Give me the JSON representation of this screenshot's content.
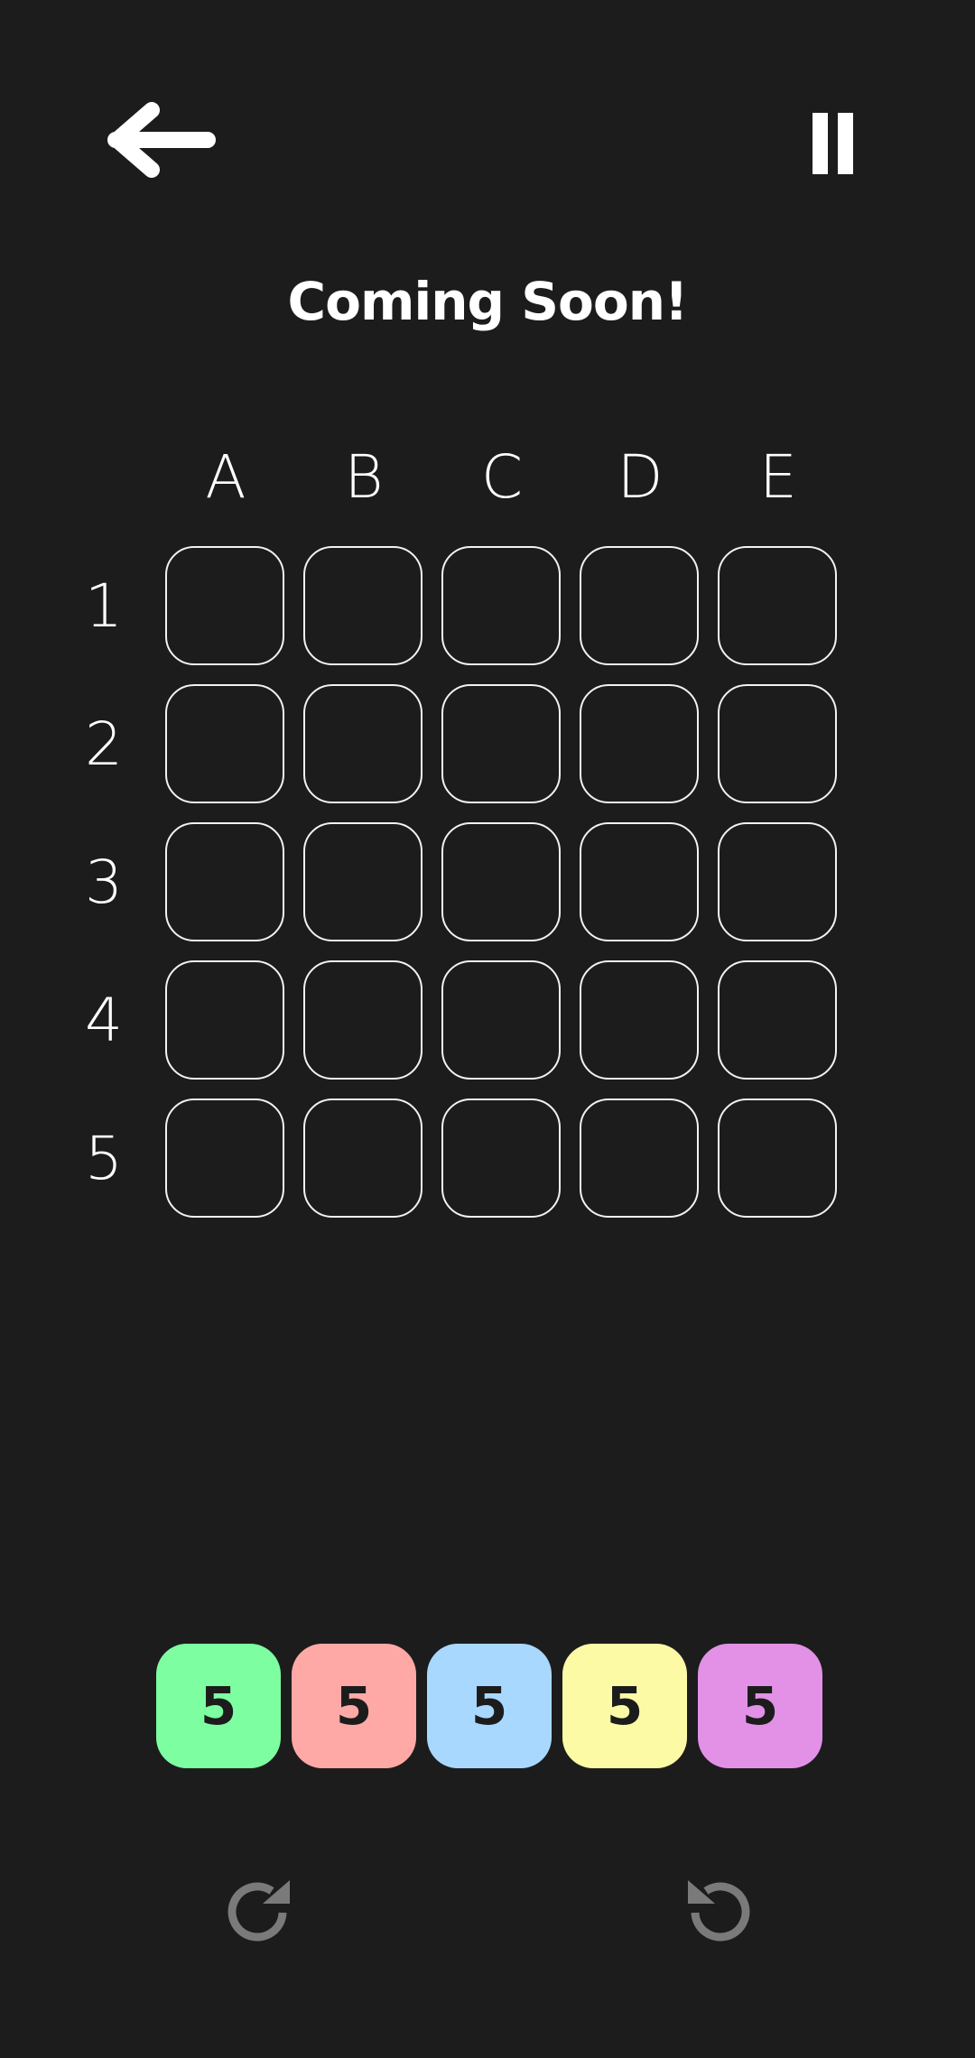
{
  "header": {
    "back_icon": "arrow-left-icon",
    "pause_icon": "pause-icon",
    "title": "Coming Soon!"
  },
  "grid": {
    "columns": [
      "A",
      "B",
      "C",
      "D",
      "E"
    ],
    "rows": [
      "1",
      "2",
      "3",
      "4",
      "5"
    ],
    "cell_border_color": "#f2f2f2"
  },
  "tiles": [
    {
      "label": "5",
      "color": "#7dfea1"
    },
    {
      "label": "5",
      "color": "#fea9a6"
    },
    {
      "label": "5",
      "color": "#a8d8fe"
    },
    {
      "label": "5",
      "color": "#fdfaa6"
    },
    {
      "label": "5",
      "color": "#e291e7"
    }
  ],
  "controls": {
    "redo_icon": "redo-icon",
    "undo_icon": "undo-icon",
    "icon_color": "#7a7a7a"
  },
  "colors": {
    "background": "#1c1c1c",
    "text": "#ffffff"
  }
}
